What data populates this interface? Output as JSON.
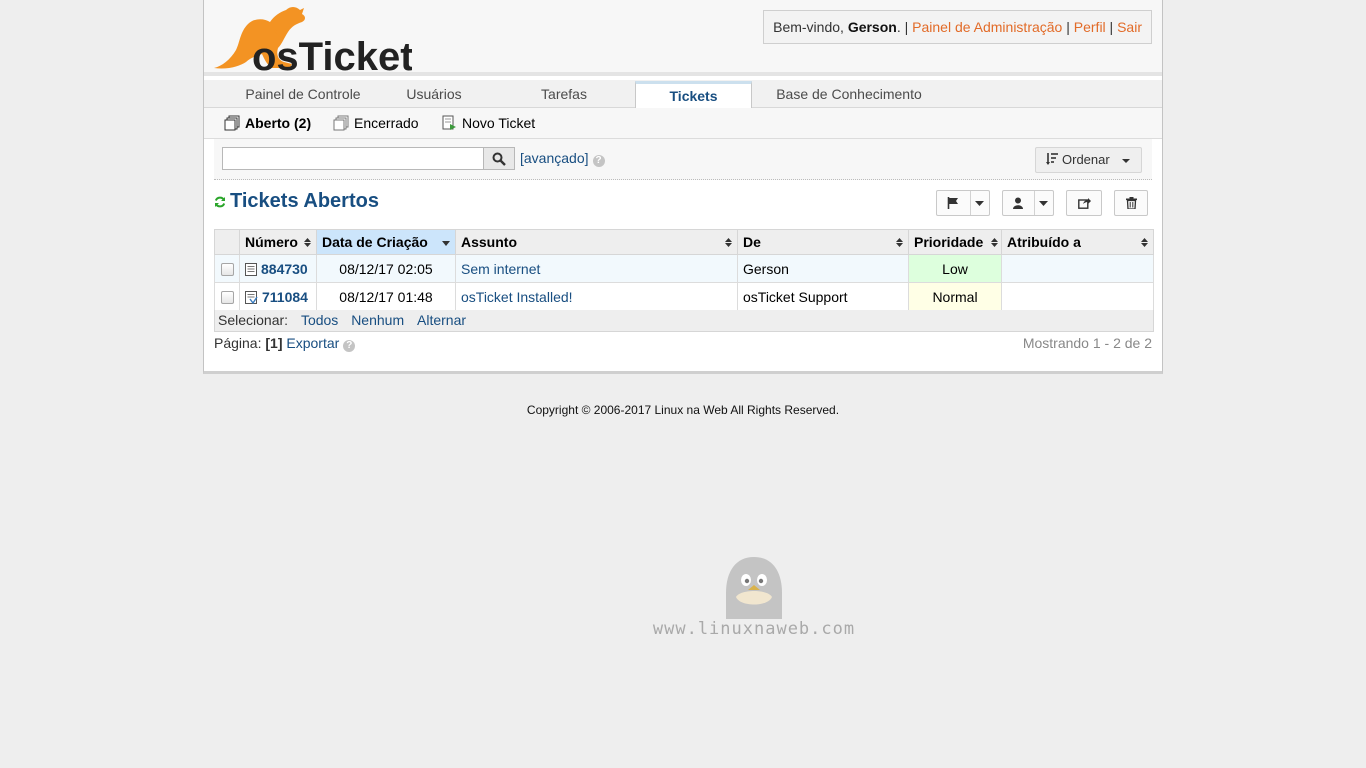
{
  "header": {
    "logo_text": "osTicket",
    "welcome_prefix": "Bem-vindo, ",
    "user_name": "Gerson",
    "welcome_suffix": ". | ",
    "admin_link": "Painel de Administração",
    "sep1": " | ",
    "profile_link": "Perfil",
    "sep2": " | ",
    "logout_link": "Sair"
  },
  "nav": {
    "tabs": [
      {
        "label": "Painel de Controle"
      },
      {
        "label": "Usuários"
      },
      {
        "label": "Tarefas"
      },
      {
        "label": "Tickets",
        "active": true
      },
      {
        "label": "Base de Conhecimento"
      }
    ]
  },
  "subnav": {
    "open": "Aberto (2)",
    "closed": "Encerrado",
    "new_ticket": "Novo Ticket"
  },
  "search": {
    "value": "",
    "placeholder": "",
    "advanced": "[avançado]",
    "sort_label": "Ordenar"
  },
  "list": {
    "title": "Tickets Abertos",
    "columns": [
      "Número",
      "Data de Criação",
      "Assunto",
      "De",
      "Prioridade",
      "Atribuído a"
    ],
    "rows": [
      {
        "number": "884730",
        "date": "08/12/17 02:05",
        "subject": "Sem internet",
        "from": "Gerson",
        "priority": "Low",
        "assigned": ""
      },
      {
        "number": "711084",
        "date": "08/12/17 01:48",
        "subject": "osTicket Installed!",
        "from": "osTicket Support",
        "priority": "Normal",
        "assigned": ""
      }
    ],
    "select_label": "Selecionar:",
    "select_all": "Todos",
    "select_none": "Nenhum",
    "select_toggle": "Alternar",
    "page_label": "Página: ",
    "page_current": "[1]",
    "export": "Exportar",
    "showing": "Mostrando 1 - 2 de 2"
  },
  "footer": {
    "copyright": "Copyright © 2006-2017 Linux na Web All Rights Reserved."
  },
  "watermark": {
    "text": "www.linuxnaweb.com"
  },
  "colors": {
    "link": "#184e81",
    "header_link": "#e26b28",
    "logo_orange": "#f39323",
    "priority_low": "#ddffdd",
    "priority_normal": "#ffffe6"
  }
}
